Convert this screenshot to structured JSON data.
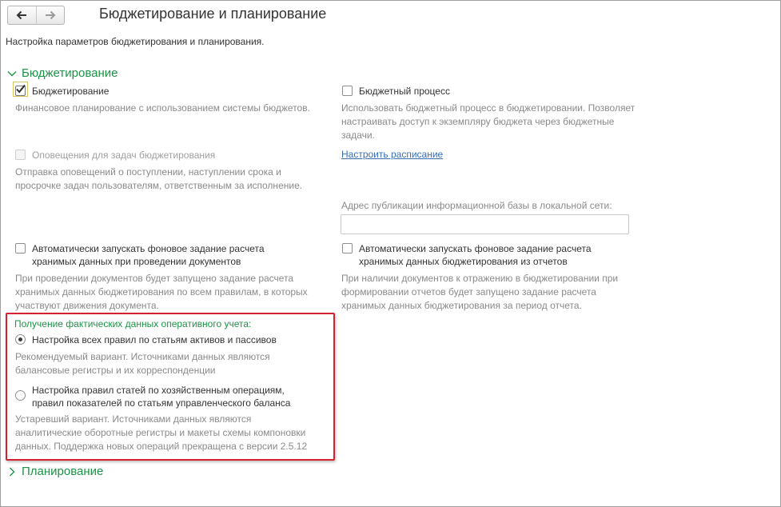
{
  "nav": {
    "back_icon": "arrow-left-icon",
    "forward_icon": "arrow-right-icon"
  },
  "page": {
    "title": "Бюджетирование и планирование",
    "subtitle": "Настройка параметров бюджетирования и планирования."
  },
  "budgeting_group": {
    "title": "Бюджетирование",
    "left": {
      "budgeting": {
        "label": "Бюджетирование",
        "checked": true,
        "hint": "Финансовое планирование с использованием системы бюджетов."
      },
      "notifications": {
        "label": "Оповещения для задач бюджетирования",
        "checked": false,
        "disabled": true,
        "hint_lines": [
          "Отправка оповещений о поступлении, наступлении срока и",
          "просрочке задач пользователям, ответственным за исполнение."
        ]
      },
      "auto_post": {
        "label_lines": [
          "Автоматически запускать фоновое задание расчета",
          "хранимых данных при проведении документов"
        ],
        "checked": false,
        "hint_lines": [
          "При проведении документов будет запущено задание расчета",
          "хранимых данных бюджетирования по всем правилам, в которых",
          "участвуют движения документа."
        ]
      }
    },
    "right": {
      "budget_process": {
        "label": "Бюджетный процесс",
        "checked": false,
        "hint_lines": [
          "Использовать бюджетный процесс в бюджетировании. Позволяет",
          "настраивать доступ к экземпляру бюджета через бюджетные",
          "задачи."
        ]
      },
      "schedule_link": "Настроить расписание",
      "publication_address": {
        "label": "Адрес публикации информационной базы в локальной сети:",
        "value": ""
      },
      "auto_reports": {
        "label_lines": [
          "Автоматически запускать фоновое задание расчета",
          "хранимых данных бюджетирования из отчетов"
        ],
        "checked": false,
        "hint_lines": [
          "При наличии документов к отражению в бюджетировании при",
          "формировании отчетов будет запущено задание расчета",
          "хранимых данных бюджетирования за период отчета."
        ]
      }
    },
    "actuals": {
      "title": "Получение фактических данных оперативного учета:",
      "option1": {
        "label": "Настройка всех правил по статьям активов и пассивов",
        "selected": true,
        "hint_lines": [
          "Рекомендуемый вариант. Источниками данных являются",
          "балансовые регистры и их корреспонденции"
        ]
      },
      "option2": {
        "label_lines": [
          "Настройка правил статей по хозяйственным операциям,",
          "правил показателей по статьям управленческого баланса"
        ],
        "selected": false,
        "hint_lines": [
          "Устаревший вариант. Источниками данных являются",
          "аналитические оборотные регистры и макеты схемы компоновки",
          "данных. Поддержка новых операций прекращена с версии 2.5.12"
        ]
      }
    }
  },
  "planning_group": {
    "title": "Планирование"
  },
  "colors": {
    "group_title": "#1b9446",
    "hint": "#8a8a8a",
    "link": "#3b6fb6",
    "highlight_border": "#d5212f"
  }
}
